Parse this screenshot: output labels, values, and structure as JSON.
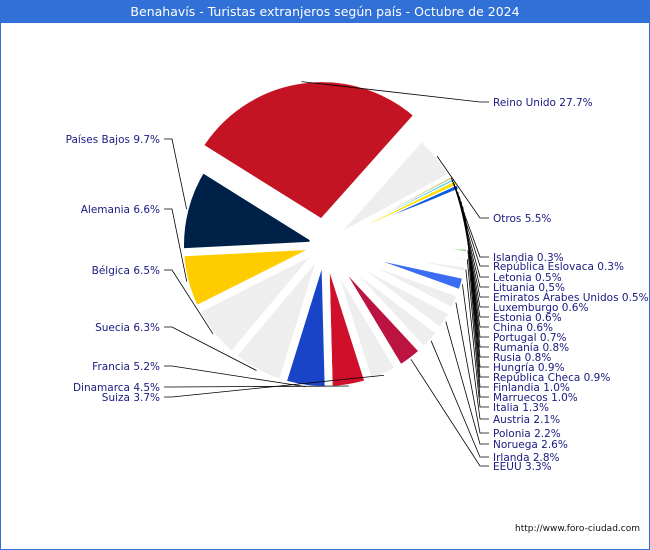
{
  "title": "Benahavís - Turistas extranjeros según país - Octubre de 2024",
  "footer": "http://www.foro-ciudad.com",
  "chart_data": {
    "type": "pie",
    "title": "Benahavís - Turistas extranjeros según país - Octubre de 2024",
    "unit": "%",
    "slices": [
      {
        "label": "Reino Unido",
        "value": 27.7,
        "color": "#c41424",
        "exploded": true,
        "side": "right"
      },
      {
        "label": "Otros",
        "value": 5.5,
        "color": "#eeeeee",
        "exploded": false,
        "side": "right"
      },
      {
        "label": "Islandia",
        "value": 0.3,
        "color": "#d4c87a",
        "exploded": false,
        "side": "right"
      },
      {
        "label": "República Eslovaca",
        "value": 0.3,
        "color": "#4ccaf0",
        "exploded": false,
        "side": "right"
      },
      {
        "label": "Letonia",
        "value": 0.5,
        "color": "#ffe000",
        "exploded": false,
        "side": "right"
      },
      {
        "label": "Lituania",
        "value": 0.5,
        "color": "#0a5ce0",
        "exploded": false,
        "side": "right"
      },
      {
        "label": "Emiratos Árabes Unidos",
        "value": 0.5,
        "color": "#eeeeee",
        "exploded": false,
        "side": "right"
      },
      {
        "label": "Luxemburgo",
        "value": 0.6,
        "color": "#eeeeee",
        "exploded": false,
        "side": "right"
      },
      {
        "label": "Estonia",
        "value": 0.6,
        "color": "#eeeeee",
        "exploded": false,
        "side": "right"
      },
      {
        "label": "China",
        "value": 0.6,
        "color": "#eeeeee",
        "exploded": false,
        "side": "right"
      },
      {
        "label": "Portugal",
        "value": 0.7,
        "color": "#eeeeee",
        "exploded": false,
        "side": "right"
      },
      {
        "label": "Rumanía",
        "value": 0.8,
        "color": "#eeeeee",
        "exploded": false,
        "side": "right"
      },
      {
        "label": "Rusia",
        "value": 0.8,
        "color": "#eeeeee",
        "exploded": false,
        "side": "right"
      },
      {
        "label": "Hungría",
        "value": 0.9,
        "color": "#eeeeee",
        "exploded": false,
        "side": "right"
      },
      {
        "label": "República Checa",
        "value": 0.9,
        "color": "#e02818",
        "exploded": false,
        "side": "right"
      },
      {
        "label": "Finlandia",
        "value": 1.0,
        "color": "#2e9a10",
        "exploded": false,
        "side": "right"
      },
      {
        "label": "Marruecos",
        "value": 1.0,
        "color": "#eeeeee",
        "exploded": false,
        "side": "right"
      },
      {
        "label": "Italia",
        "value": 1.3,
        "color": "#eeeeee",
        "exploded": false,
        "side": "right"
      },
      {
        "label": "Austria",
        "value": 2.1,
        "color": "#3a6cf4",
        "exploded": false,
        "side": "right"
      },
      {
        "label": "Polonia",
        "value": 2.2,
        "color": "#eeeeee",
        "exploded": false,
        "side": "right"
      },
      {
        "label": "Noruega",
        "value": 2.6,
        "color": "#eeeeee",
        "exploded": false,
        "side": "right"
      },
      {
        "label": "Irlanda",
        "value": 2.8,
        "color": "#eeeeee",
        "exploded": false,
        "side": "right"
      },
      {
        "label": "EEUU",
        "value": 3.3,
        "color": "#bc1440",
        "exploded": false,
        "side": "right"
      },
      {
        "label": "Suiza",
        "value": 3.7,
        "color": "#eeeeee",
        "exploded": false,
        "side": "left"
      },
      {
        "label": "Dinamarca",
        "value": 4.5,
        "color": "#d0102a",
        "exploded": false,
        "side": "left"
      },
      {
        "label": "Francia",
        "value": 5.2,
        "color": "#1a44c8",
        "exploded": false,
        "side": "left"
      },
      {
        "label": "Suecia",
        "value": 6.3,
        "color": "#eeeeee",
        "exploded": false,
        "side": "left"
      },
      {
        "label": "Bélgica",
        "value": 6.5,
        "color": "#eeeeee",
        "exploded": false,
        "side": "left"
      },
      {
        "label": "Alemania",
        "value": 6.6,
        "color": "#ffcc00",
        "exploded": false,
        "side": "left"
      },
      {
        "label": "Países Bajos",
        "value": 9.7,
        "color": "#002147",
        "exploded": false,
        "side": "left"
      }
    ],
    "label_color": "#1a1a80",
    "legend": "none"
  }
}
